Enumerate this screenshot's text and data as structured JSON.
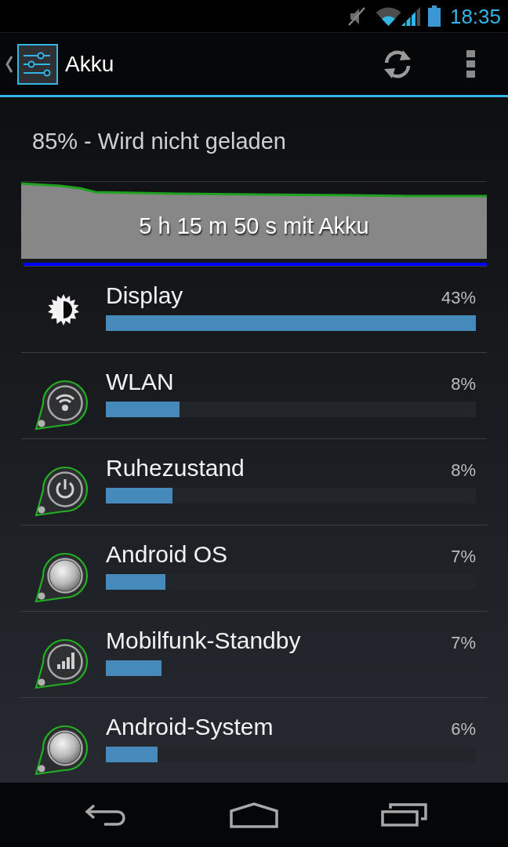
{
  "status_bar": {
    "time": "18:35"
  },
  "action_bar": {
    "title": "Akku"
  },
  "battery_status": "85% - Wird nicht geladen",
  "history": {
    "label": "5 h 15 m 50 s mit Akku"
  },
  "usage": [
    {
      "name": "Display",
      "percent": "43%",
      "level": 1.0
    },
    {
      "name": "WLAN",
      "percent": "8%",
      "level": 0.2
    },
    {
      "name": "Ruhezustand",
      "percent": "8%",
      "level": 0.18
    },
    {
      "name": "Android OS",
      "percent": "7%",
      "level": 0.16
    },
    {
      "name": "Mobilfunk-Standby",
      "percent": "7%",
      "level": 0.15
    },
    {
      "name": "Android-System",
      "percent": "6%",
      "level": 0.14
    }
  ]
}
